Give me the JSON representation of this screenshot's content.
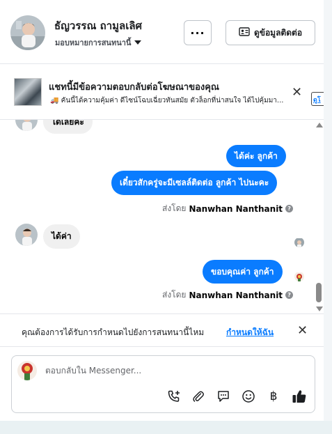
{
  "header": {
    "name": "ธัญวรรณ ถามูลเลิศ",
    "assign_label": "มอบหมายการสนทนานี้",
    "more_label": "···",
    "contact_button_label": "ดูข้อมูลติดต่อ"
  },
  "banner": {
    "title": "แชทนี้มีข้อความตอบกลับต่อโฆษณาของคุณ",
    "subtitle": "🚚 คันนี้ได้ความคุ้มค่า ดีไซน์โฉบเฉี่ยวทันสมัย ตัวล็อกที่น่าสนใจ ได้ไปคุ้มมา...",
    "view_label": "ดูโ"
  },
  "messages": [
    {
      "direction": "in",
      "text": "ได้เลยค่ะ"
    },
    {
      "direction": "out",
      "text": "ได้ค่ะ ลูกค้า"
    },
    {
      "direction": "out",
      "text": "เดี๋ยวสักครู่จะมีเซลล์ติดต่อ ลูกค้า ไปนะคะ"
    },
    {
      "direction": "in",
      "text": "ได้ค่า"
    },
    {
      "direction": "out",
      "text": "ขอบคุณค่า ลูกค้า"
    }
  ],
  "sent_by": {
    "prefix": "ส่งโดย",
    "name": "Nanwhan Nanthanit",
    "help_icon": "?"
  },
  "assign_prompt": {
    "text": "คุณต้องการได้รับการกำหนดไปยังการสนทนานี้ไหม",
    "link": "กำหนดให้ฉัน"
  },
  "composer": {
    "placeholder": "ตอบกลับใน Messenger...",
    "tools": [
      "phone-add-icon",
      "attachment-icon",
      "saved-reply-icon",
      "emoji-icon",
      "baht-payment-icon",
      "like-icon"
    ],
    "baht_glyph": "฿"
  },
  "colors": {
    "accent": "#0a7cff",
    "incoming_bubble": "#f0f0f0",
    "text_secondary": "#65676b"
  }
}
